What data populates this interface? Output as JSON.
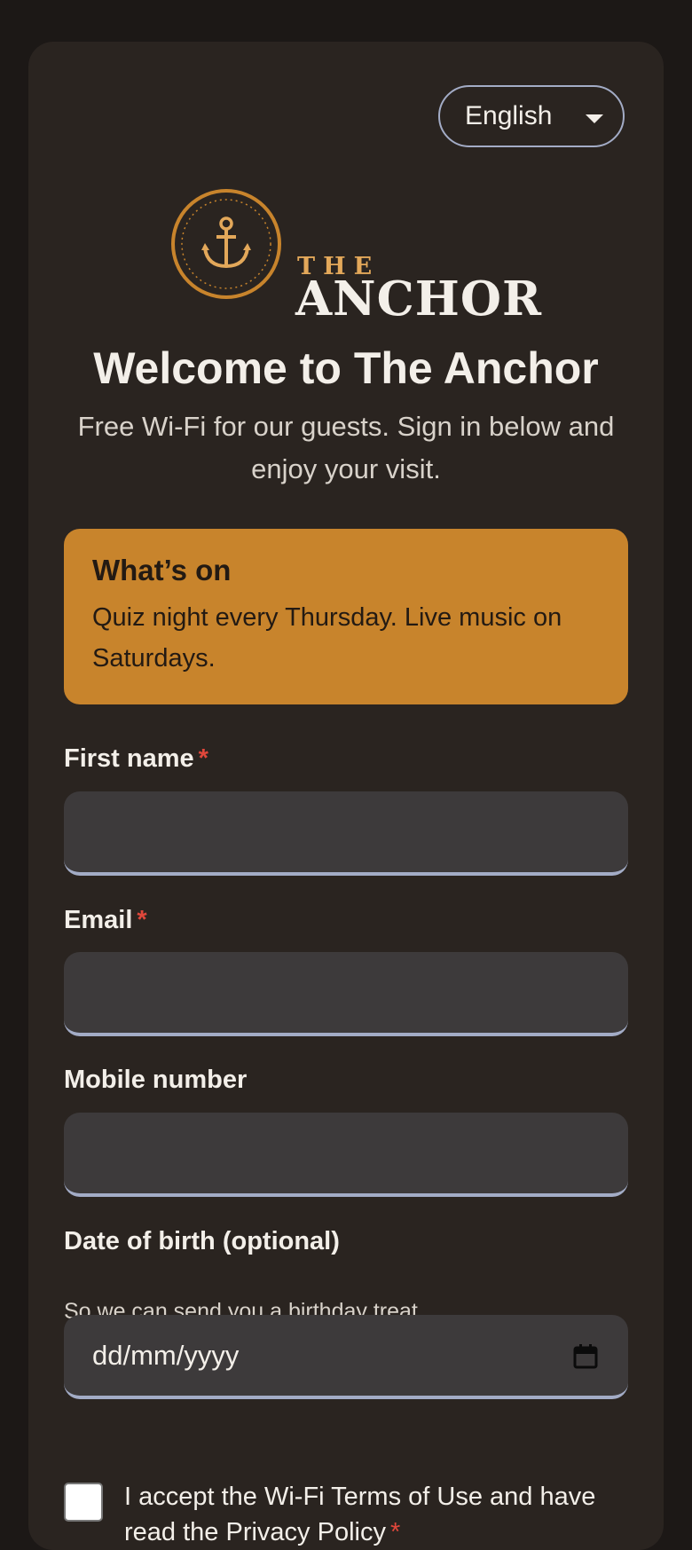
{
  "language": {
    "selected": "English"
  },
  "brand": {
    "logo_small": "THE",
    "logo_large": "ANCHOR",
    "colors": {
      "accent": "#c8842c",
      "card": "#2a2420",
      "field": "#3d3a3b",
      "required": "#e0473b"
    }
  },
  "welcome": {
    "title": "Welcome to The Anchor",
    "subtitle": "Free Wi-Fi for our guests. Sign in below and enjoy your visit."
  },
  "promo": {
    "title": "What’s on",
    "text": "Quiz night every Thursday. Live music on Saturdays."
  },
  "form": {
    "required_marker": "*",
    "first_name": {
      "label": "First name",
      "value": ""
    },
    "email": {
      "label": "Email",
      "value": ""
    },
    "mobile": {
      "label": "Mobile number",
      "value": ""
    },
    "dob": {
      "label": "Date of birth (optional)",
      "hint": "So we can send you a birthday treat.",
      "placeholder": "dd/mm/yyyy",
      "icon": "calendar-icon"
    },
    "terms": {
      "text": "I accept the Wi-Fi Terms of Use and have read the Privacy Policy",
      "checked": false
    }
  }
}
